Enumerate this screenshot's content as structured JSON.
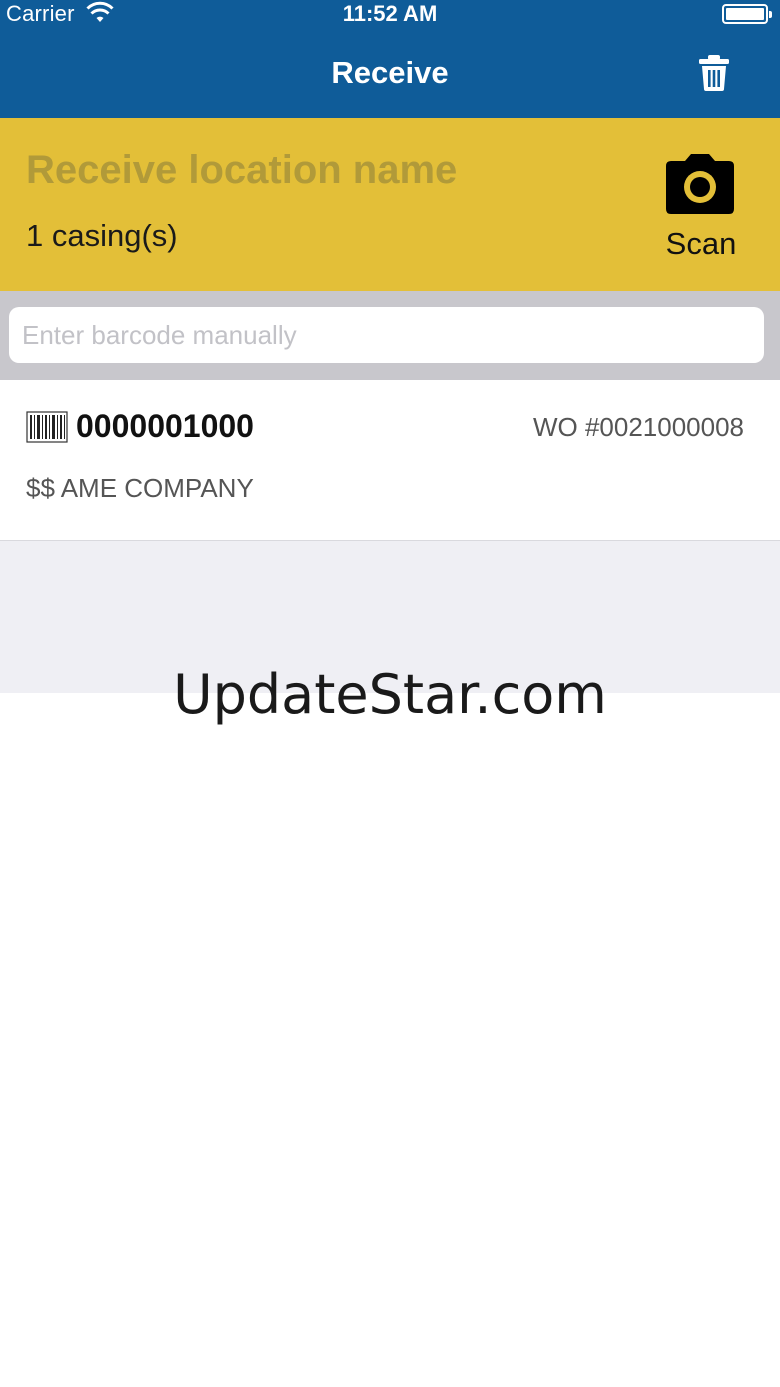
{
  "status_bar": {
    "carrier": "Carrier",
    "time": "11:52 AM"
  },
  "nav": {
    "title": "Receive",
    "trash_icon": "trash-icon"
  },
  "location": {
    "name": "Receive location name",
    "casings": "1 casing(s)",
    "scan_label": "Scan",
    "camera_icon": "camera-icon",
    "background_color": "#e3bf38"
  },
  "search": {
    "placeholder": "Enter barcode manually",
    "value": ""
  },
  "items": [
    {
      "barcode": "0000001000",
      "work_order": "WO #0021000008",
      "company": "$$ AME COMPANY",
      "icon": "barcode-icon"
    }
  ],
  "watermark": "UpdateStar.com",
  "colors": {
    "nav_blue": "#0f5c99",
    "accent_yellow": "#e3bf38"
  }
}
